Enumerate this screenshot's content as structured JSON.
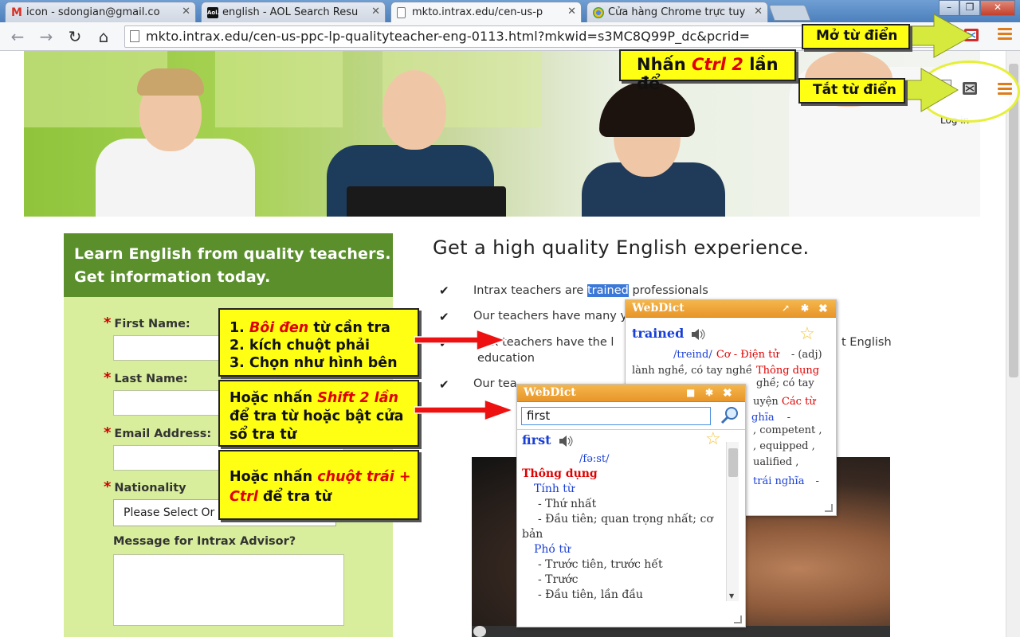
{
  "browser": {
    "tabs": [
      {
        "title": "icon - sdongian@gmail.co",
        "favicon": "M",
        "favicon_color": "#d93025",
        "active": false
      },
      {
        "title": "english - AOL Search Resu",
        "favicon": "Aol.",
        "favicon_color": "#000000",
        "active": false
      },
      {
        "title": "mkto.intrax.edu/cen-us-p",
        "favicon": "page-icon",
        "favicon_color": "#888888",
        "active": true
      },
      {
        "title": "Cửa hàng Chrome trực tuy",
        "favicon": "chrome-store-icon",
        "favicon_color": "#4a8af4",
        "active": false
      }
    ],
    "url": "mkto.intrax.edu/cen-us-ppc-lp-qualityteacher-eng-0113.html?mkwid=s3MC8Q99P_dc&pcrid="
  },
  "page": {
    "form": {
      "title_line1": "Learn English from quality teachers.",
      "title_line2": "Get information today.",
      "first_name_label": "First Name:",
      "last_name_label": "Last Name:",
      "email_label": "Email Address:",
      "nationality_label": "Nationality",
      "nationality_value": "Please Select Or",
      "message_label": "Message for Intrax Advisor?",
      "required_mark": "*"
    },
    "headline": "Get a high quality English experience.",
    "bullets": {
      "b1_before": "Intrax teachers are ",
      "b1_highlight": "trained",
      "b1_after": " professionals",
      "b2": "Our teachers have many y",
      "b3_start": "ax teachers have the l",
      "b3_end": "t English",
      "b3_line2": "education",
      "b4": "Our tea"
    }
  },
  "annotations": {
    "open_dict": "Mở từ điển",
    "press_ctrl_prefix": "Nhấn ",
    "press_ctrl_red": "Ctrl 2",
    "press_ctrl_suffix": " lần để",
    "close_dict": "Tắt từ điển",
    "steps": {
      "s1_prefix": "1. ",
      "s1_red": "Bôi đen",
      "s1_suffix": " từ cần tra",
      "s2": "2. kích chuột phải",
      "s3": "3. Chọn như hình bên"
    },
    "shift": {
      "prefix": "Hoặc nhấn ",
      "red": "Shift 2 lần",
      "line2": "để tra từ hoặc bật cửa",
      "line3": "sổ tra từ"
    },
    "ctrl_click": {
      "prefix": "Hoặc nhấn ",
      "red": "chuột trái +",
      "red2": "Ctrl",
      "suffix": " để tra từ"
    },
    "login_partial": "Log in"
  },
  "webdict_trained": {
    "title": "WebDict",
    "word": "trained",
    "pron": "/treind/",
    "category": "Cơ - Điện tử",
    "pos": "- (adj)",
    "meaning_line": "lành nghề, có tay nghề",
    "common": "Thông dụng",
    "r1": "ghề; có tay",
    "r2_prefix": "uyện ",
    "r2_red": "Các từ",
    "r3": "ghĩa",
    "r3_dash": "-",
    "r4": ", competent ,",
    "r5": ", equipped ,",
    "r6": "ualified ,",
    "r7_blue": "trái nghĩa",
    "r7_dash": "-"
  },
  "webdict_first": {
    "title": "WebDict",
    "search_value": "first",
    "word": "first",
    "pron": "/fə:st/",
    "common": "Thông dụng",
    "adj_label": "Tính từ",
    "adj_m1": "-  Thứ nhất",
    "adj_m2a": "-  Đầu tiên; quan trọng nhất; cơ",
    "adj_m2b": "bản",
    "adv_label": "Phó từ",
    "adv_m1": "-  Trước tiên, trước hết",
    "adv_m2": "-  Trước",
    "adv_m3": "-  Đầu tiên, lần đầu"
  }
}
